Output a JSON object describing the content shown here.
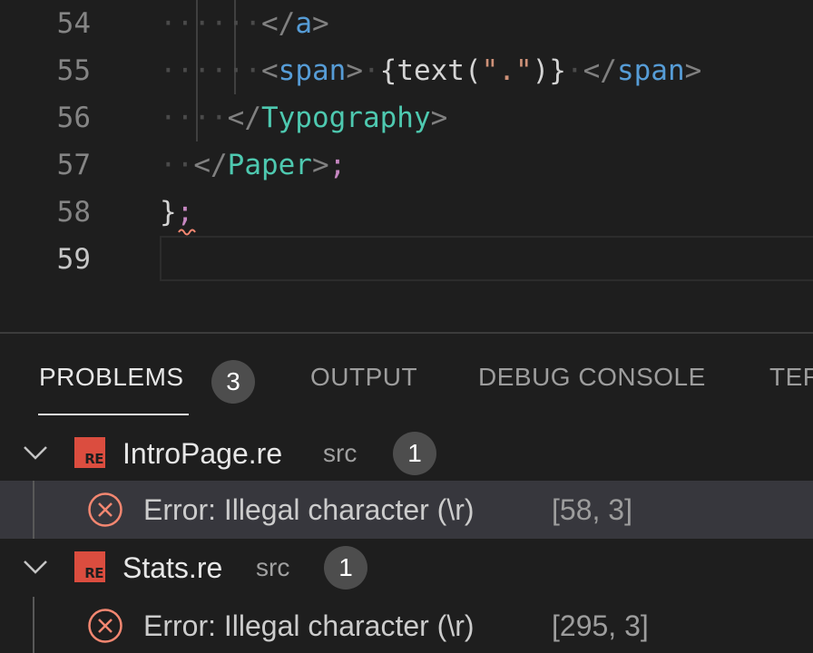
{
  "editor": {
    "line_numbers": [
      "54",
      "55",
      "56",
      "57",
      "58",
      "59"
    ],
    "lines": [
      {
        "open": "</",
        "tag": "a",
        "close": ">"
      },
      {
        "open1": "<",
        "tag1": "span",
        "close1": ">",
        "expr_open": "{text(",
        "string": "\".\"",
        "expr_close": ")}",
        "open2": "</",
        "tag2": "span",
        "close2": ">"
      },
      {
        "open": "</",
        "tag": "Typography",
        "close": ">"
      },
      {
        "open": "</",
        "tag": "Paper",
        "close": ">",
        "semi": ";"
      },
      {
        "brace": "}",
        "semi": ";"
      },
      {}
    ]
  },
  "panel": {
    "tabs": [
      {
        "label": "PROBLEMS",
        "badge": "3"
      },
      {
        "label": "OUTPUT"
      },
      {
        "label": "DEBUG CONSOLE"
      },
      {
        "label": "TERMINAL"
      }
    ],
    "files": [
      {
        "name": "IntroPage.re",
        "dir": "src",
        "count": "1",
        "icon_label": "RE",
        "errors": [
          {
            "message": "Error: Illegal character (\\r)",
            "position": "[58, 3]"
          }
        ]
      },
      {
        "name": "Stats.re",
        "dir": "src",
        "count": "1",
        "icon_label": "RE",
        "errors": [
          {
            "message": "Error: Illegal character (\\r)",
            "position": "[295, 3]"
          }
        ]
      }
    ]
  },
  "colors": {
    "background": "#1e1e1e",
    "tag": "#569cd6",
    "component": "#4ec9b0",
    "string": "#ce9178",
    "error": "#f48771",
    "reason_icon": "#db4d3f"
  }
}
